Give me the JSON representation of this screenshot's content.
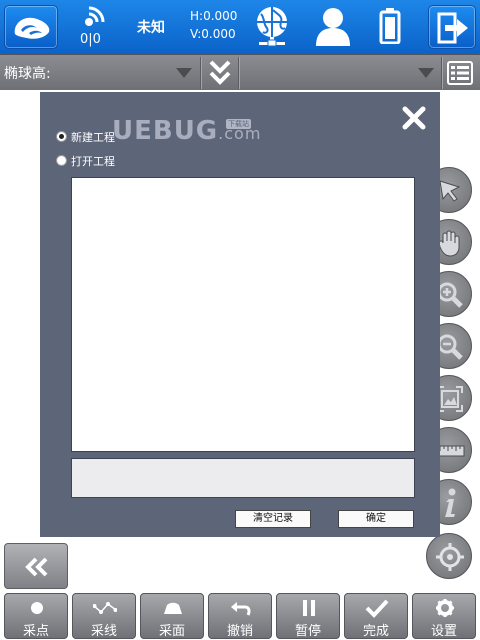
{
  "topbar": {
    "satellite_count": "0|0",
    "solution_status": "未知",
    "h_precision": "H:0.000",
    "v_precision": "V:0.000",
    "icons": [
      "app-logo-icon",
      "satellite-signal-icon",
      "network-globe-icon",
      "user-icon",
      "battery-icon",
      "exit-icon"
    ]
  },
  "secondbar": {
    "ellipsoid_height_label": "椭球高:",
    "icons": [
      "dropdown-arrow-icon",
      "double-chevron-down-icon",
      "dropdown-arrow-icon",
      "list-menu-icon"
    ]
  },
  "dialog": {
    "new_project_label": "新建工程",
    "open_project_label": "打开工程",
    "selected_option": "新建工程",
    "project_list_items": [],
    "path_value": "",
    "clear_history_label": "清空记录",
    "ok_label": "确定",
    "watermark_text": "UEBUG",
    "watermark_suffix": ".com",
    "watermark_tag": "下载站"
  },
  "tools": [
    "pointer-icon",
    "pan-hand-icon",
    "zoom-in-icon",
    "zoom-out-icon",
    "full-extent-icon",
    "ruler-icon",
    "info-icon",
    "locate-icon"
  ],
  "bottombar": {
    "buttons": [
      {
        "label": "采点",
        "icon": "dot-icon"
      },
      {
        "label": "采线",
        "icon": "polyline-icon"
      },
      {
        "label": "采面",
        "icon": "polygon-icon"
      },
      {
        "label": "撤销",
        "icon": "undo-icon"
      },
      {
        "label": "暂停",
        "icon": "pause-icon"
      },
      {
        "label": "完成",
        "icon": "check-icon"
      },
      {
        "label": "设置",
        "icon": "gear-icon"
      }
    ]
  }
}
